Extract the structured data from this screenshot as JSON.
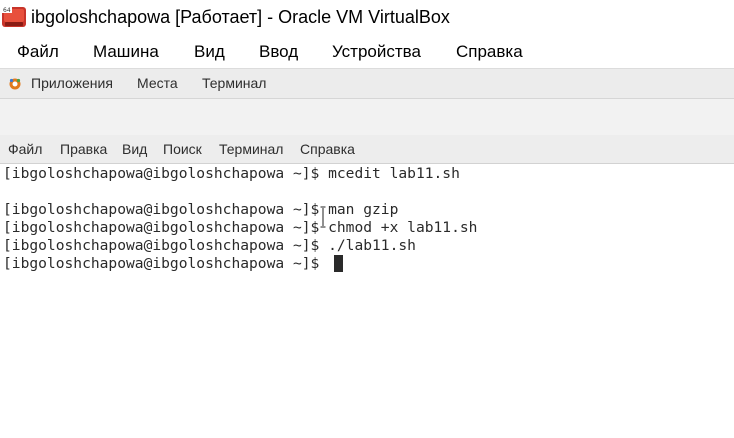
{
  "window": {
    "title": "ibgoloshchapowa [Работает] - Oracle VM VirtualBox",
    "icon": "virtualbox-icon"
  },
  "vbox_menu": [
    {
      "label": "Файл"
    },
    {
      "label": "Машина"
    },
    {
      "label": "Вид"
    },
    {
      "label": "Ввод"
    },
    {
      "label": "Устройства"
    },
    {
      "label": "Справка"
    }
  ],
  "gnome_panel": {
    "icon": "applications-icon",
    "items": [
      {
        "label": "Приложения"
      },
      {
        "label": "Места"
      },
      {
        "label": "Терминал"
      }
    ]
  },
  "terminal_menu": [
    {
      "label": "Файл"
    },
    {
      "label": "Правка"
    },
    {
      "label": "Вид"
    },
    {
      "label": "Поиск"
    },
    {
      "label": "Терминал"
    },
    {
      "label": "Справка"
    }
  ],
  "terminal": {
    "lines": [
      "[ibgoloshchapowa@ibgoloshchapowa ~]$ mcedit lab11.sh",
      "",
      "[ibgoloshchapowa@ibgoloshchapowa ~]$ man gzip",
      "[ibgoloshchapowa@ibgoloshchapowa ~]$ chmod +x lab11.sh",
      "[ibgoloshchapowa@ibgoloshchapowa ~]$ ./lab11.sh",
      "[ibgoloshchapowa@ibgoloshchapowa ~]$ "
    ]
  }
}
